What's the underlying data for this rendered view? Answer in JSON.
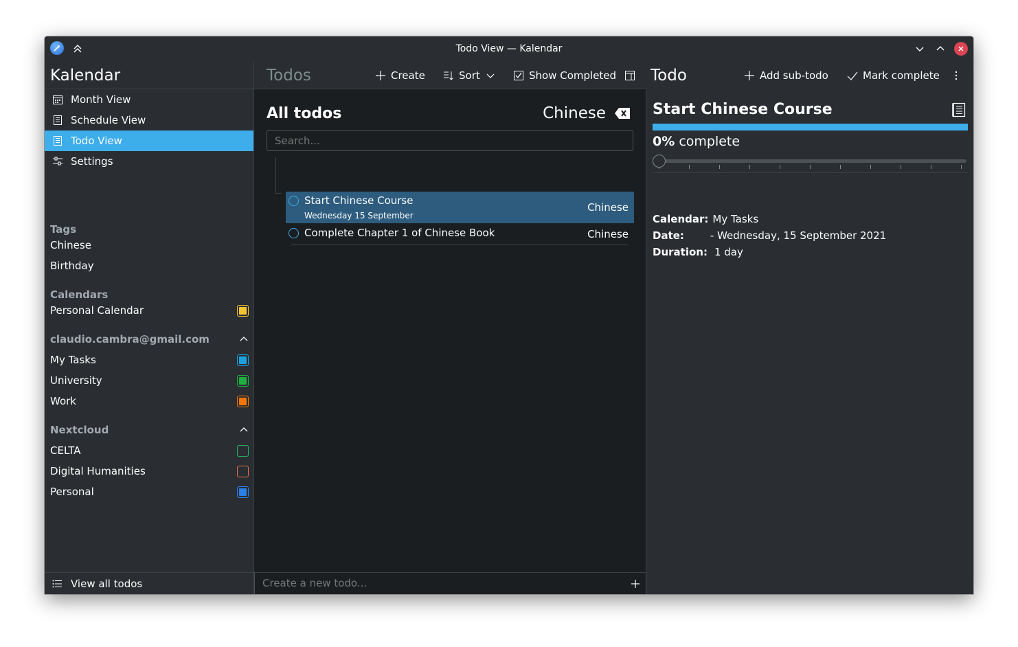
{
  "window": {
    "title": "Todo View — Kalendar"
  },
  "sidebar": {
    "app_title": "Kalendar",
    "nav": [
      {
        "label": "Month View",
        "icon": "calendar-month-icon"
      },
      {
        "label": "Schedule View",
        "icon": "list-icon"
      },
      {
        "label": "Todo View",
        "icon": "list-icon",
        "active": true
      },
      {
        "label": "Settings",
        "icon": "settings-sliders-icon"
      }
    ],
    "tags_title": "Tags",
    "tags": [
      "Chinese",
      "Birthday"
    ],
    "calendars_title": "Calendars",
    "calendars": [
      {
        "label": "Personal Calendar",
        "color": "#f4c430"
      }
    ],
    "account_title": "claudio.cambra@gmail.com",
    "account_calendars": [
      {
        "label": "My Tasks",
        "color": "#1ba1e2"
      },
      {
        "label": "University",
        "color": "#1faf40"
      },
      {
        "label": "Work",
        "color": "#f67400"
      }
    ],
    "nextcloud_title": "Nextcloud",
    "nextcloud_calendars": [
      {
        "label": "CELTA",
        "color": "#27ae60",
        "filled": false
      },
      {
        "label": "Digital Humanities",
        "color": "#e0704b",
        "filled": false
      },
      {
        "label": "Personal",
        "color": "#2980e9",
        "filled": true
      }
    ],
    "footer_label": "View all todos"
  },
  "middle": {
    "title": "Todos",
    "toolbar": {
      "create": "Create",
      "sort": "Sort",
      "show_completed": "Show Completed"
    },
    "list_title": "All todos",
    "filter_tag": "Chinese",
    "search_placeholder": "Search...",
    "todos": [
      {
        "title": "Start Chinese Course",
        "date": "Wednesday 15 September",
        "tag": "Chinese",
        "selected": true
      },
      {
        "title": "Complete Chapter 1 of Chinese Book",
        "date": "",
        "tag": "Chinese",
        "selected": false
      }
    ],
    "new_todo_placeholder": "Create a new todo..."
  },
  "detail": {
    "title": "Todo",
    "toolbar": {
      "add_subtodo": "Add sub-todo",
      "mark_complete": "Mark complete"
    },
    "todo_title": "Start Chinese Course",
    "percent": "0%",
    "percent_suffix": "complete",
    "progress": 0,
    "calendar_label": "Calendar:",
    "calendar_value": "My Tasks",
    "date_label": "Date:",
    "date_value": "- Wednesday, 15 September 2021",
    "duration_label": "Duration:",
    "duration_value": "1 day"
  },
  "colors": {
    "accent": "#3daee9",
    "selected_row": "#2d5c7f",
    "close": "#da4453"
  }
}
